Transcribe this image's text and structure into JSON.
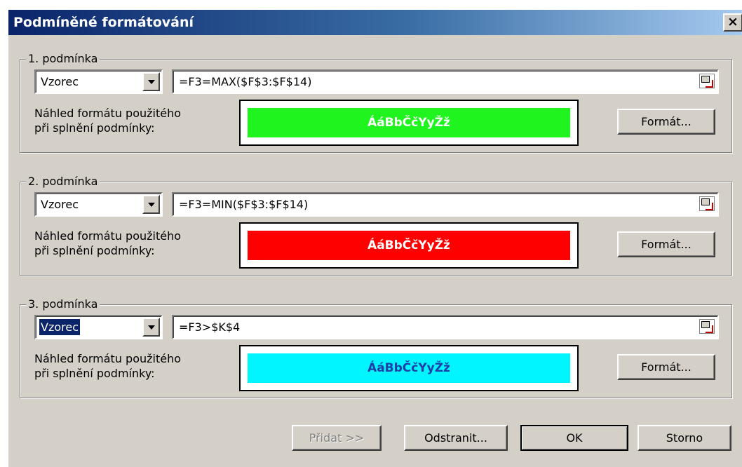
{
  "dialog": {
    "title": "Podmíněné formátování",
    "close_label": "×"
  },
  "conditions": [
    {
      "legend": "1. podmínka",
      "type": "Vzorec",
      "type_selected": false,
      "formula": "=F3=MAX($F$3:$F$14)",
      "hint_line1": "Náhled formátu použitého",
      "hint_line2": "při splnění podmínky:",
      "preview_text": "ÁáBbČčYyŽž",
      "preview_bg": "#1ff41f",
      "preview_fg": "#ffffff",
      "format_button": "Formát..."
    },
    {
      "legend": "2. podmínka",
      "type": "Vzorec",
      "type_selected": false,
      "formula": "=F3=MIN($F$3:$F$14)",
      "hint_line1": "Náhled formátu použitého",
      "hint_line2": "při splnění podmínky:",
      "preview_text": "ÁáBbČčYyŽž",
      "preview_bg": "#ff0000",
      "preview_fg": "#ffffff",
      "format_button": "Formát..."
    },
    {
      "legend": "3. podmínka",
      "type": "Vzorec",
      "type_selected": true,
      "formula": "=F3>$K$4",
      "hint_line1": "Náhled formátu použitého",
      "hint_line2": "při splnění podmínky:",
      "preview_text": "ÁáBbČčYyŽž",
      "preview_bg": "#00f5ff",
      "preview_fg": "#1f3fa8",
      "format_button": "Formát..."
    }
  ],
  "footer": {
    "add": "Přidat >>",
    "remove": "Odstranit...",
    "ok": "OK",
    "cancel": "Storno"
  }
}
